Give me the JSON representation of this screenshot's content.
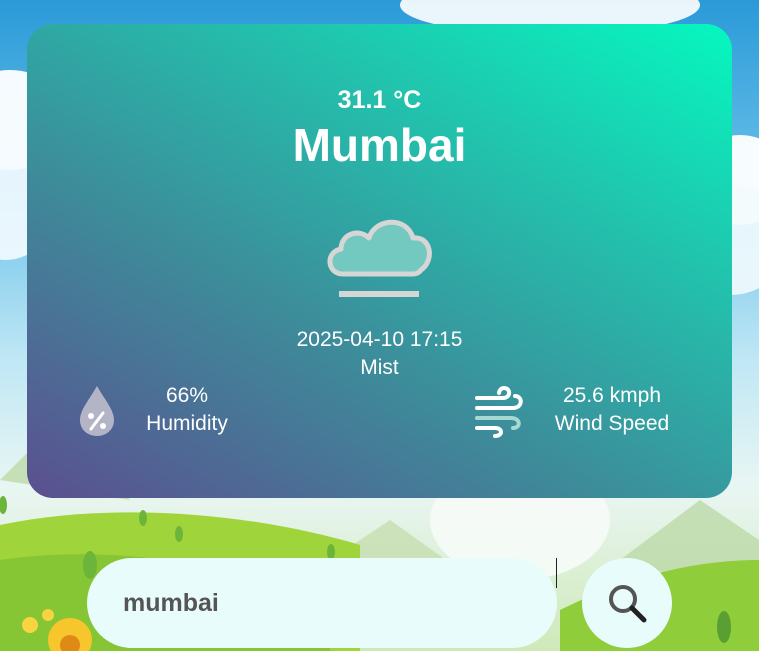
{
  "weather": {
    "temperature": "31.1 °C",
    "city": "Mumbai",
    "icon": "mist-cloud-icon",
    "datetime": "2025-04-10 17:15",
    "description": "Mist"
  },
  "humidity": {
    "value": "66%",
    "label": "Humidity",
    "icon": "humidity-drop-icon"
  },
  "wind": {
    "value": "25.6 kmph",
    "label": "Wind Speed",
    "icon": "wind-icon"
  },
  "search": {
    "value": "mumbai",
    "button_icon": "search-icon"
  },
  "colors": {
    "card_gradient_start": "#5b4f90",
    "card_gradient_mid": "#3d8c9a",
    "card_gradient_end": "#05f8bf",
    "search_background": "#e8fdfb",
    "text": "#ffffff"
  }
}
